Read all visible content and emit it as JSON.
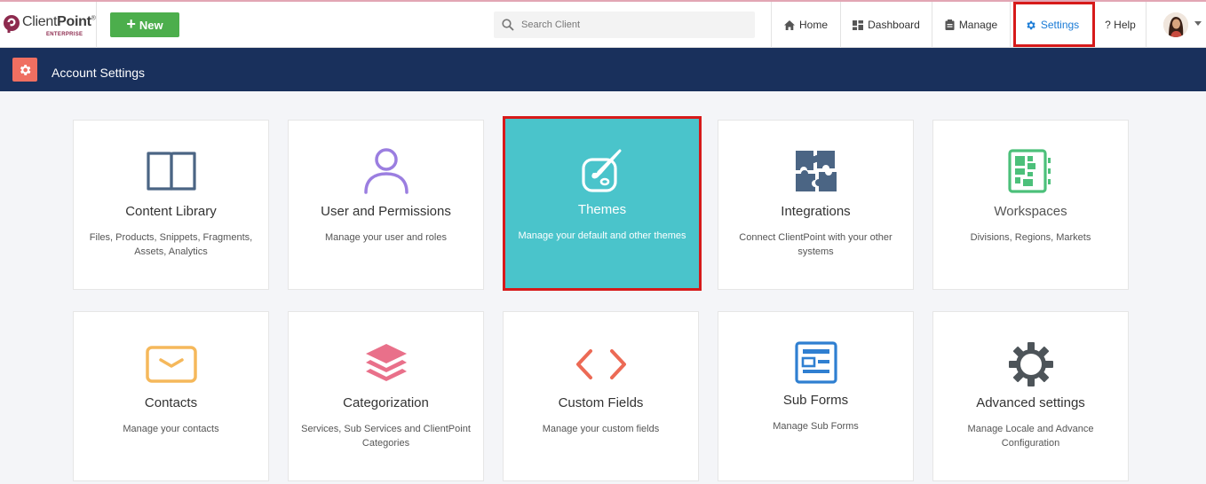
{
  "app": {
    "logo_text_light": "Client",
    "logo_text_bold": "Point",
    "logo_reg": "®",
    "logo_sub": "ENTERPRISE"
  },
  "toolbar": {
    "new_label": "New",
    "search_placeholder": "Search Client"
  },
  "nav": {
    "home": "Home",
    "dashboard": "Dashboard",
    "manage": "Manage",
    "settings": "Settings",
    "help": "? Help"
  },
  "header": {
    "title": "Account Settings"
  },
  "cards": [
    {
      "title": "Content Library",
      "desc": "Files, Products, Snippets, Fragments, Assets, Analytics",
      "icon": "book-icon"
    },
    {
      "title": "User and Permissions",
      "desc": "Manage your user and roles",
      "icon": "user-icon"
    },
    {
      "title": "Themes",
      "desc": "Manage your default and other themes",
      "icon": "palette-icon"
    },
    {
      "title": "Integrations",
      "desc": "Connect ClientPoint with your other systems",
      "icon": "puzzle-icon"
    },
    {
      "title": "Workspaces",
      "desc": "Divisions, Regions, Markets",
      "icon": "workspace-icon"
    },
    {
      "title": "Contacts",
      "desc": "Manage your contacts",
      "icon": "envelope-icon"
    },
    {
      "title": "Categorization",
      "desc": "Services, Sub Services and ClientPoint Categories",
      "icon": "layers-icon"
    },
    {
      "title": "Custom Fields",
      "desc": "Manage your custom fields",
      "icon": "code-icon"
    },
    {
      "title": "Sub Forms",
      "desc": "Manage Sub Forms",
      "icon": "form-icon"
    },
    {
      "title": "Advanced settings",
      "desc": "Manage Locale and Advance Configuration",
      "icon": "gear-icon"
    }
  ],
  "colors": {
    "band": "#19305c",
    "accent": "#4ac4cb",
    "highlight": "#d71a1a",
    "new_button": "#4cae4c"
  }
}
